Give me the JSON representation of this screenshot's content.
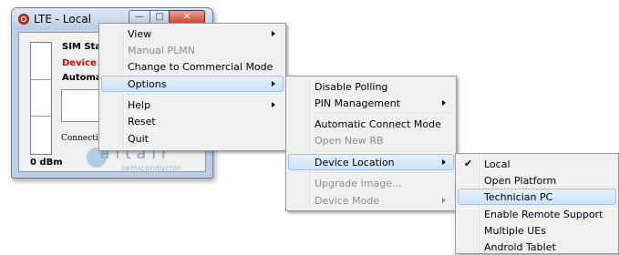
{
  "window": {
    "title": "LTE - Local",
    "min_glyph": "—",
    "max_glyph": "□",
    "close_glyph": "✕",
    "labels": {
      "sim_status": "SIM Statu",
      "device": "Device N",
      "automatic": "Automatic",
      "connection": "Connection",
      "signal": "0 dBm"
    },
    "logo": {
      "word": "altair",
      "sub": "semiconductor"
    }
  },
  "main_menu": {
    "items": [
      {
        "label": "View",
        "submenu": true,
        "disabled": false
      },
      {
        "label": "Manual PLMN",
        "submenu": false,
        "disabled": true
      },
      {
        "label": "Change to Commercial Mode",
        "submenu": false,
        "disabled": false
      },
      {
        "label": "Options",
        "submenu": true,
        "disabled": false,
        "highlighted": true
      },
      {
        "label": "Help",
        "submenu": true,
        "disabled": false
      },
      {
        "label": "Reset",
        "submenu": false,
        "disabled": false
      },
      {
        "label": "Quit",
        "submenu": false,
        "disabled": false
      }
    ]
  },
  "options_menu": {
    "items": [
      {
        "label": "Disable Polling",
        "submenu": false,
        "disabled": false
      },
      {
        "label": "PIN Management",
        "submenu": true,
        "disabled": false
      },
      {
        "label": "Automatic Connect Mode",
        "submenu": false,
        "disabled": false
      },
      {
        "label": "Open New RB",
        "submenu": false,
        "disabled": true
      },
      {
        "label": "Device Location",
        "submenu": true,
        "disabled": false,
        "highlighted": true
      },
      {
        "label": "Upgrade Image...",
        "submenu": false,
        "disabled": true
      },
      {
        "label": "Device Mode",
        "submenu": true,
        "disabled": true
      }
    ]
  },
  "location_menu": {
    "check_glyph": "✔",
    "items": [
      {
        "label": "Local",
        "checked": true
      },
      {
        "label": "Open Platform",
        "checked": false
      },
      {
        "label": "Technician PC",
        "checked": false,
        "highlighted": true
      },
      {
        "label": "Enable Remote Support",
        "checked": false
      },
      {
        "label": "Multiple UEs",
        "checked": false
      },
      {
        "label": "Android Tablet",
        "checked": false
      }
    ]
  }
}
